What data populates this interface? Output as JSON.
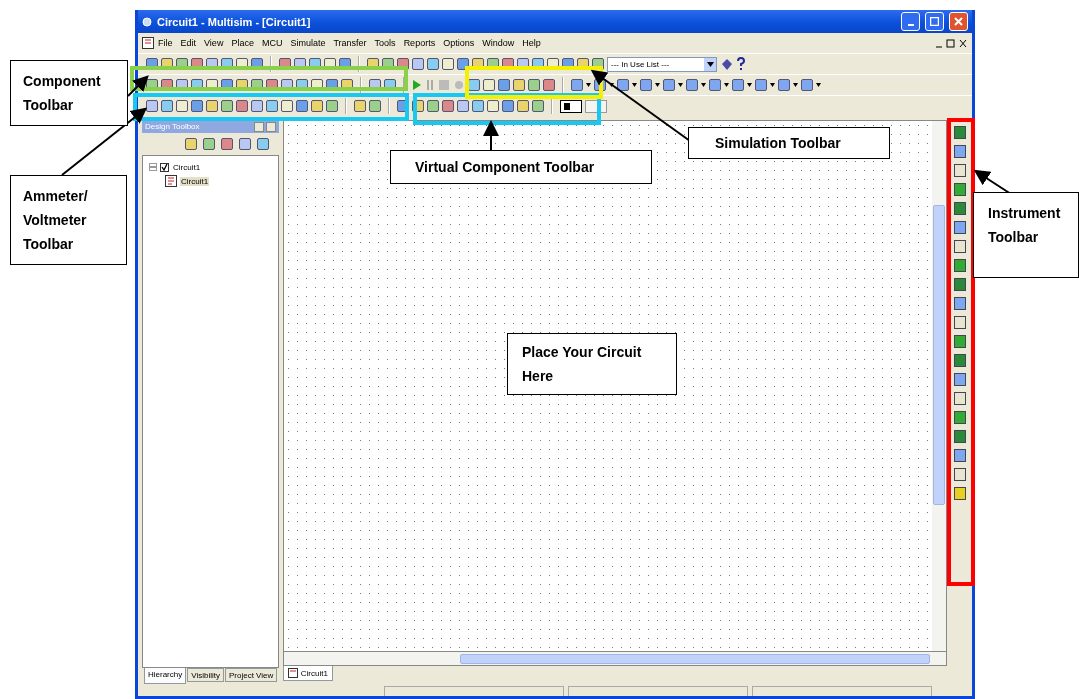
{
  "window": {
    "title": "Circuit1 - Multisim - [Circuit1]"
  },
  "menu": [
    "File",
    "Edit",
    "View",
    "Place",
    "MCU",
    "Simulate",
    "Transfer",
    "Tools",
    "Reports",
    "Options",
    "Window",
    "Help"
  ],
  "in_use_list": {
    "value": "--- In Use List ---"
  },
  "design_toolbox": {
    "title": "Design Toolbox",
    "tree": [
      {
        "label": "Circuit1",
        "checked": true,
        "expanded": true,
        "children": [
          {
            "label": "Circuit1",
            "selected": true
          }
        ]
      }
    ],
    "tabs": [
      {
        "label": "Hierarchy",
        "selected": true
      },
      {
        "label": "Visibility",
        "selected": false
      },
      {
        "label": "Project View",
        "selected": false
      }
    ]
  },
  "sheet_tabs": [
    {
      "label": "Circuit1",
      "selected": true
    }
  ],
  "annotations": [
    {
      "kind": "component",
      "label": "Component Toolbar"
    },
    {
      "kind": "ammeter",
      "label": "Ammeter/ Voltmeter Toolbar"
    },
    {
      "kind": "simulation",
      "label": "Simulation Toolbar"
    },
    {
      "kind": "virtual",
      "label": "Virtual Component Toolbar"
    },
    {
      "kind": "instrument",
      "label": "Instrument Toolbar"
    },
    {
      "kind": "canvas",
      "label": "Place Your Circuit Here"
    }
  ]
}
